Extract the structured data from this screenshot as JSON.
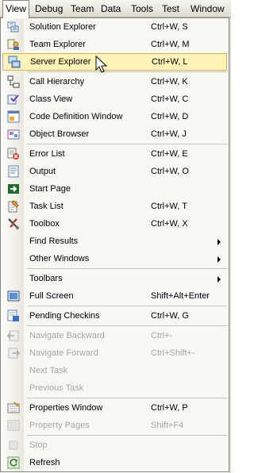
{
  "menubar": {
    "items": [
      "View",
      "Debug",
      "Team",
      "Data",
      "Tools",
      "Test",
      "Window"
    ]
  },
  "menu": {
    "items": [
      {
        "label": "Solution Explorer",
        "shortcut": "Ctrl+W, S",
        "icon": "solution-explorer-icon"
      },
      {
        "label": "Team Explorer",
        "shortcut": "Ctrl+W, M",
        "icon": "team-explorer-icon"
      },
      {
        "label": "Server Explorer",
        "shortcut": "Ctrl+W, L",
        "icon": "server-explorer-icon"
      },
      {
        "label": "Call Hierarchy",
        "shortcut": "Ctrl+W, K",
        "icon": "call-hierarchy-icon"
      },
      {
        "label": "Class View",
        "shortcut": "Ctrl+W, C",
        "icon": "class-view-icon"
      },
      {
        "label": "Code Definition Window",
        "shortcut": "Ctrl+W, D",
        "icon": "code-definition-icon"
      },
      {
        "label": "Object Browser",
        "shortcut": "Ctrl+W, J",
        "icon": "object-browser-icon"
      },
      {
        "label": "Error List",
        "shortcut": "Ctrl+W, E",
        "icon": "error-list-icon"
      },
      {
        "label": "Output",
        "shortcut": "Ctrl+W, O",
        "icon": "output-icon"
      },
      {
        "label": "Start Page",
        "shortcut": "",
        "icon": "start-page-icon"
      },
      {
        "label": "Task List",
        "shortcut": "Ctrl+W, T",
        "icon": "task-list-icon"
      },
      {
        "label": "Toolbox",
        "shortcut": "Ctrl+W, X",
        "icon": "toolbox-icon"
      },
      {
        "label": "Find Results",
        "shortcut": "",
        "icon": ""
      },
      {
        "label": "Other Windows",
        "shortcut": "",
        "icon": ""
      },
      {
        "label": "Toolbars",
        "shortcut": "",
        "icon": ""
      },
      {
        "label": "Full Screen",
        "shortcut": "Shift+Alt+Enter",
        "icon": "full-screen-icon"
      },
      {
        "label": "Pending Checkins",
        "shortcut": "Ctrl+W, G",
        "icon": "pending-checkins-icon"
      },
      {
        "label": "Navigate Backward",
        "shortcut": "Ctrl+-",
        "icon": "navigate-backward-icon"
      },
      {
        "label": "Navigate Forward",
        "shortcut": "Ctrl+Shift+-",
        "icon": "navigate-forward-icon"
      },
      {
        "label": "Next Task",
        "shortcut": "",
        "icon": ""
      },
      {
        "label": "Previous Task",
        "shortcut": "",
        "icon": ""
      },
      {
        "label": "Properties Window",
        "shortcut": "Ctrl+W, P",
        "icon": "properties-window-icon"
      },
      {
        "label": "Property Pages",
        "shortcut": "Shift+F4",
        "icon": "property-pages-icon"
      },
      {
        "label": "Stop",
        "shortcut": "",
        "icon": "stop-icon"
      },
      {
        "label": "Refresh",
        "shortcut": "",
        "icon": "refresh-icon"
      }
    ]
  },
  "colors": {
    "highlight": "#fff3b8",
    "highlight_border": "#d7b44c",
    "disabled": "#a7a69f"
  }
}
